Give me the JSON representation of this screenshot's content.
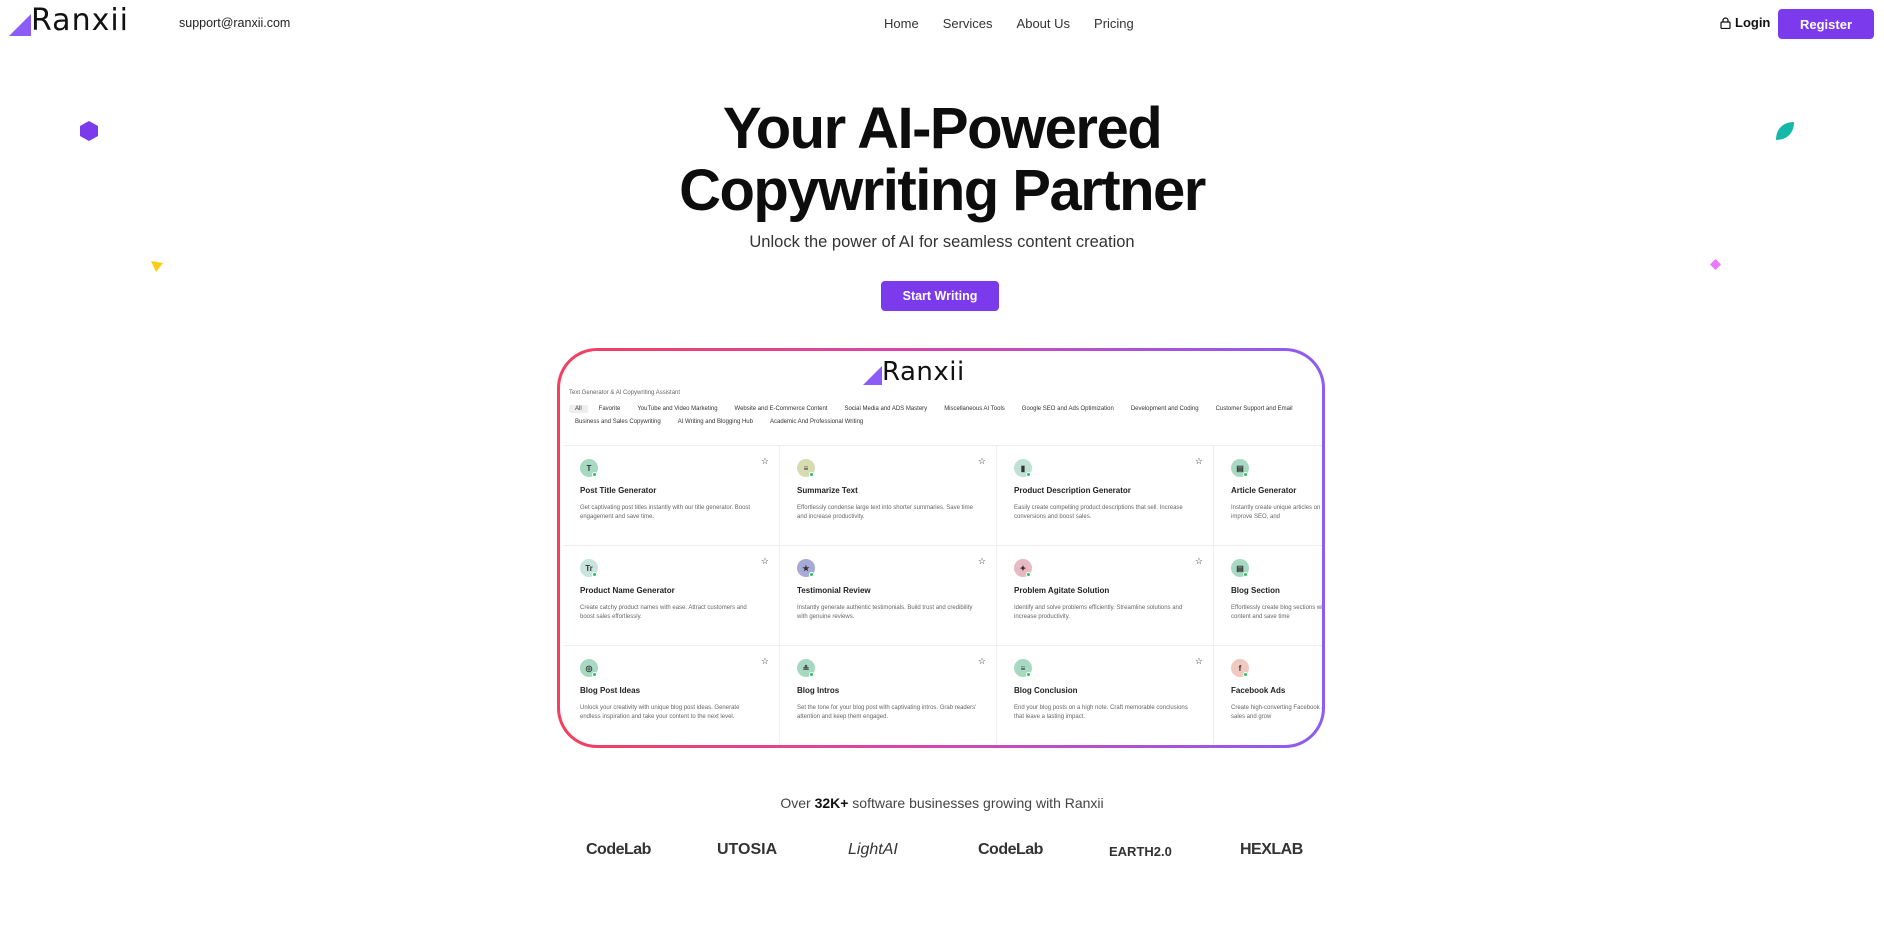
{
  "nav": {
    "logo_text": "Ranxii",
    "support_email": "support@ranxii.com",
    "menu": [
      "Home",
      "Services",
      "About Us",
      "Pricing"
    ],
    "login_label": "Login",
    "register_label": "Register"
  },
  "hero": {
    "title_line1": "Your AI-Powered",
    "title_line2": "Copywriting Partner",
    "subtitle": "Unlock the power of AI for seamless content creation",
    "cta_label": "Start Writing"
  },
  "preview": {
    "logo_text": "Ranxii",
    "subtitle": "Text Generator & AI Copywriting Assistant",
    "categories_row1": [
      "All",
      "Favorite",
      "YouTube and Video Marketing",
      "Website and E-Commerce Content",
      "Social Media and ADS Mastery",
      "Miscellaneous AI Tools",
      "Google SEO and Ads Optimization",
      "Development and Coding",
      "Customer Support and Email"
    ],
    "categories_row2": [
      "Business and Sales Copywriting",
      "AI Writing and Blogging Hub",
      "Academic And Professional Writing"
    ],
    "cards": [
      {
        "icon": "T",
        "title": "Post Title Generator",
        "desc": "Get captivating post titles instantly with our title generator. Boost engagement and save time.",
        "color": "#a7d9c2"
      },
      {
        "icon": "≡",
        "title": "Summarize Text",
        "desc": "Effortlessly condense large text into shorter summaries. Save time and increase productivity.",
        "color": "#d6dcb0"
      },
      {
        "icon": "▮",
        "title": "Product Description Generator",
        "desc": "Easily create compelling product descriptions that sell. Increase conversions and boost sales.",
        "color": "#bfe0d5"
      },
      {
        "icon": "▤",
        "title": "Article Generator",
        "desc": "Instantly create unique articles on any topic. Boost engagement, improve SEO, and",
        "color": "#a7d9c2"
      },
      {
        "icon": "Tr",
        "title": "Product Name Generator",
        "desc": "Create catchy product names with ease. Attract customers and boost sales effortlessly.",
        "color": "#c9e3dd"
      },
      {
        "icon": "★",
        "title": "Testimonial Review",
        "desc": "Instantly generate authentic testimonials. Build trust and credibility with genuine reviews.",
        "color": "#a7a9d6"
      },
      {
        "icon": "✦",
        "title": "Problem Agitate Solution",
        "desc": "Identify and solve problems efficiently. Streamline solutions and increase productivity.",
        "color": "#e8b8c3"
      },
      {
        "icon": "▤",
        "title": "Blog Section",
        "desc": "Effortlessly create blog sections with AI. Get unique, engaging content and save time",
        "color": "#a7d9c2"
      },
      {
        "icon": "◎",
        "title": "Blog Post Ideas",
        "desc": "Unlock your creativity with unique blog post ideas. Generate endless inspiration and take your content to the next level.",
        "color": "#a7d9c2"
      },
      {
        "icon": "≗",
        "title": "Blog Intros",
        "desc": "Set the tone for your blog post with captivating intros. Grab readers' attention and keep them engaged.",
        "color": "#a7d9c2"
      },
      {
        "icon": "≡",
        "title": "Blog Conclusion",
        "desc": "End your blog posts on a high note. Craft memorable conclusions that leave a lasting impact.",
        "color": "#a7d9c2"
      },
      {
        "icon": "f",
        "title": "Facebook Ads",
        "desc": "Create high-converting Facebook ads. Capture attention. Drive sales and grow",
        "color": "#f0c9c0"
      }
    ]
  },
  "social_proof": {
    "prefix": "Over ",
    "count": "32K+",
    "suffix": " software businesses growing with Ranxii"
  },
  "brands": [
    "CodeLab",
    "UTOSIA",
    "LightAI",
    "CodeLab",
    "EARTH2.0",
    "HEXLAB"
  ],
  "colors": {
    "accent": "#7c3aed",
    "frame_gradient_start": "#f43f5e",
    "frame_gradient_end": "#8b5cf6"
  }
}
